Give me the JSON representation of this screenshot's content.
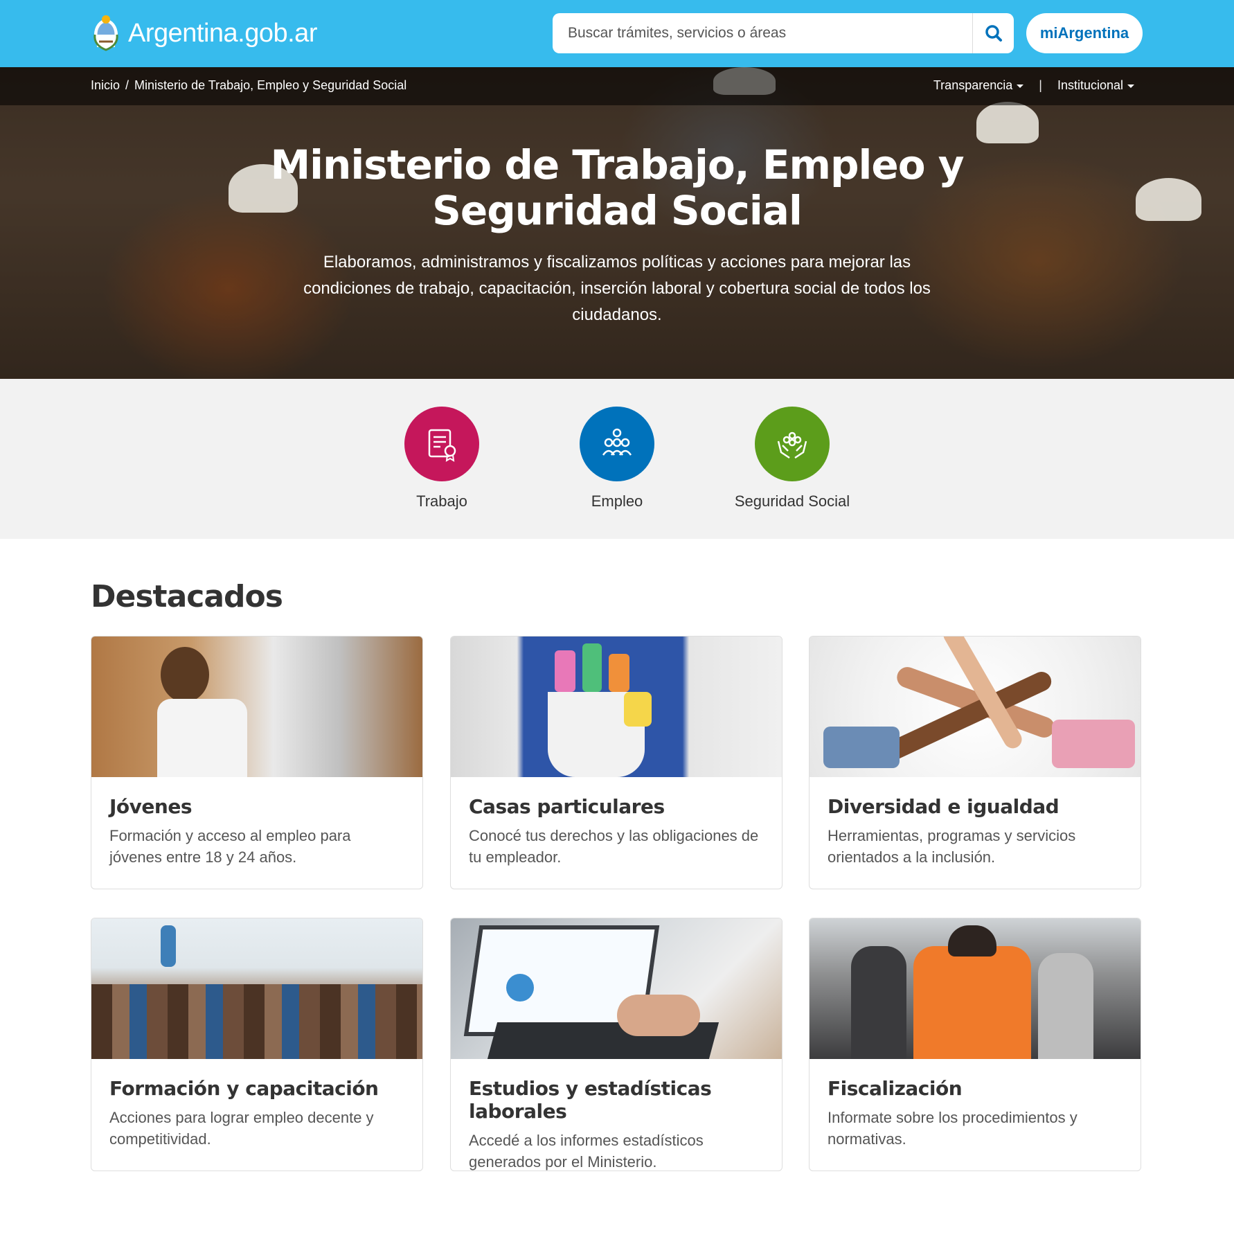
{
  "header": {
    "site_name": "Argentina.gob.ar",
    "search_placeholder": "Buscar trámites, servicios o áreas",
    "account_button": "miArgentina"
  },
  "breadcrumb": {
    "home": "Inicio",
    "separator": "/",
    "current": "Ministerio de Trabajo, Empleo y Seguridad Social"
  },
  "hero_links": {
    "transparencia": "Transparencia",
    "separator": "|",
    "institucional": "Institucional"
  },
  "hero": {
    "title": "Ministerio de Trabajo, Empleo y Seguridad Social",
    "description": "Elaboramos, administramos y fiscalizamos políticas y acciones para mejorar las condiciones de trabajo, capacitación, inserción laboral y cobertura social de todos los ciudadanos."
  },
  "categories": [
    {
      "label": "Trabajo",
      "icon": "certificate-icon",
      "color": "#c5175b"
    },
    {
      "label": "Empleo",
      "icon": "people-gear-icon",
      "color": "#0072bb"
    },
    {
      "label": "Seguridad Social",
      "icon": "hands-care-icon",
      "color": "#5c9d1b"
    }
  ],
  "destacados": {
    "title": "Destacados",
    "cards": [
      {
        "title": "Jóvenes",
        "text": "Formación y acceso al empleo para jóvenes entre 18 y 24 años."
      },
      {
        "title": "Casas particulares",
        "text": "Conocé tus derechos y las obligaciones de tu empleador."
      },
      {
        "title": "Diversidad e igualdad",
        "text": "Herramientas, programas y servicios orientados a la inclusión."
      },
      {
        "title": "Formación y capacitación",
        "text": "Acciones para lograr empleo decente y competitividad."
      },
      {
        "title": "Estudios y estadísticas laborales",
        "text": "Accedé a los informes estadísticos generados por el Ministerio."
      },
      {
        "title": "Fiscalización",
        "text": "Informate sobre los procedimientos y normativas."
      }
    ]
  },
  "colors": {
    "header_bg": "#37bbed",
    "brand_blue": "#0072bb",
    "category_bg": "#f2f2f2"
  }
}
